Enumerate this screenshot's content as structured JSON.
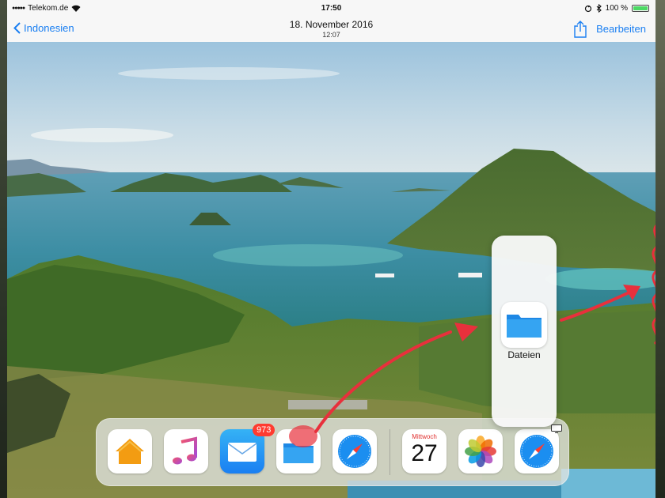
{
  "statusbar": {
    "carrier": "Telekom.de",
    "time": "17:50",
    "battery": "100 %"
  },
  "navbar": {
    "back_label": "Indonesien",
    "title": "18. November 2016",
    "subtitle": "12:07",
    "edit_label": "Bearbeiten"
  },
  "dock": {
    "apps": [
      {
        "name": "Home",
        "icon": "home-icon"
      },
      {
        "name": "Musik",
        "icon": "music-icon"
      },
      {
        "name": "Mail",
        "icon": "mail-icon",
        "badge": "973"
      },
      {
        "name": "Dateien",
        "icon": "files-icon"
      },
      {
        "name": "Safari",
        "icon": "safari-icon"
      },
      {
        "name": "Kalender",
        "icon": "calendar-icon",
        "day": "Mittwoch",
        "date": "27"
      },
      {
        "name": "Fotos",
        "icon": "photos-icon"
      },
      {
        "name": "Safari",
        "icon": "safari-icon"
      }
    ]
  },
  "drag_popup": {
    "label": "Dateien",
    "icon": "files-folder-icon"
  },
  "colors": {
    "accent": "#1a7ff2",
    "badge": "#ff3b30",
    "annotation": "#e8303c"
  }
}
